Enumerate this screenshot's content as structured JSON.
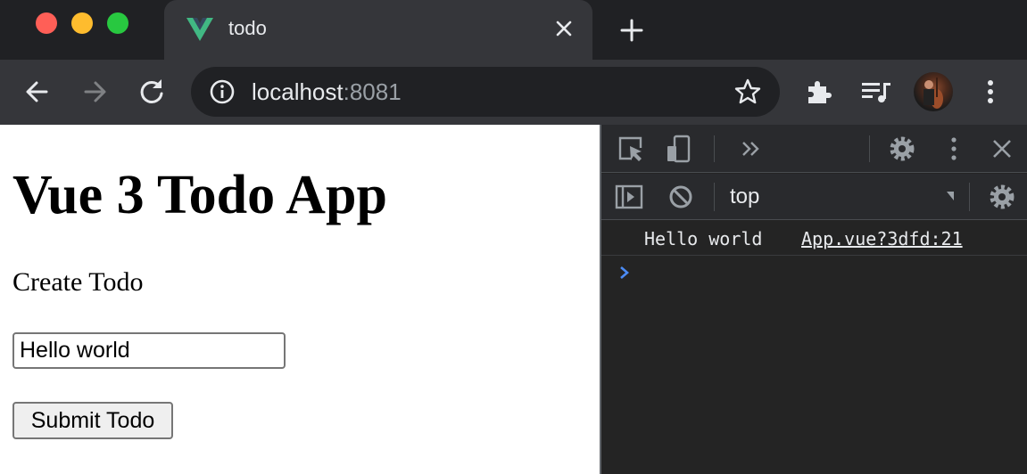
{
  "browser": {
    "tab": {
      "title": "todo",
      "favicon": "vue-logo-icon"
    },
    "omnibox": {
      "host": "localhost",
      "port": ":8081"
    },
    "icons": [
      "back-icon",
      "forward-icon",
      "reload-icon",
      "info-icon",
      "star-icon",
      "extensions-icon",
      "media-queue-icon",
      "profile-avatar",
      "more-icon"
    ]
  },
  "page": {
    "heading": "Vue 3 Todo App",
    "subheading": "Create Todo",
    "input_value": "Hello world",
    "submit_label": "Submit Todo"
  },
  "devtools": {
    "context": "top",
    "console": [
      {
        "text": "Hello world",
        "source": "App.vue?3dfd:21"
      }
    ]
  },
  "colors": {
    "vue_green": "#41b883",
    "vue_dark": "#35495e",
    "prompt_blue": "#4b8bf5"
  }
}
